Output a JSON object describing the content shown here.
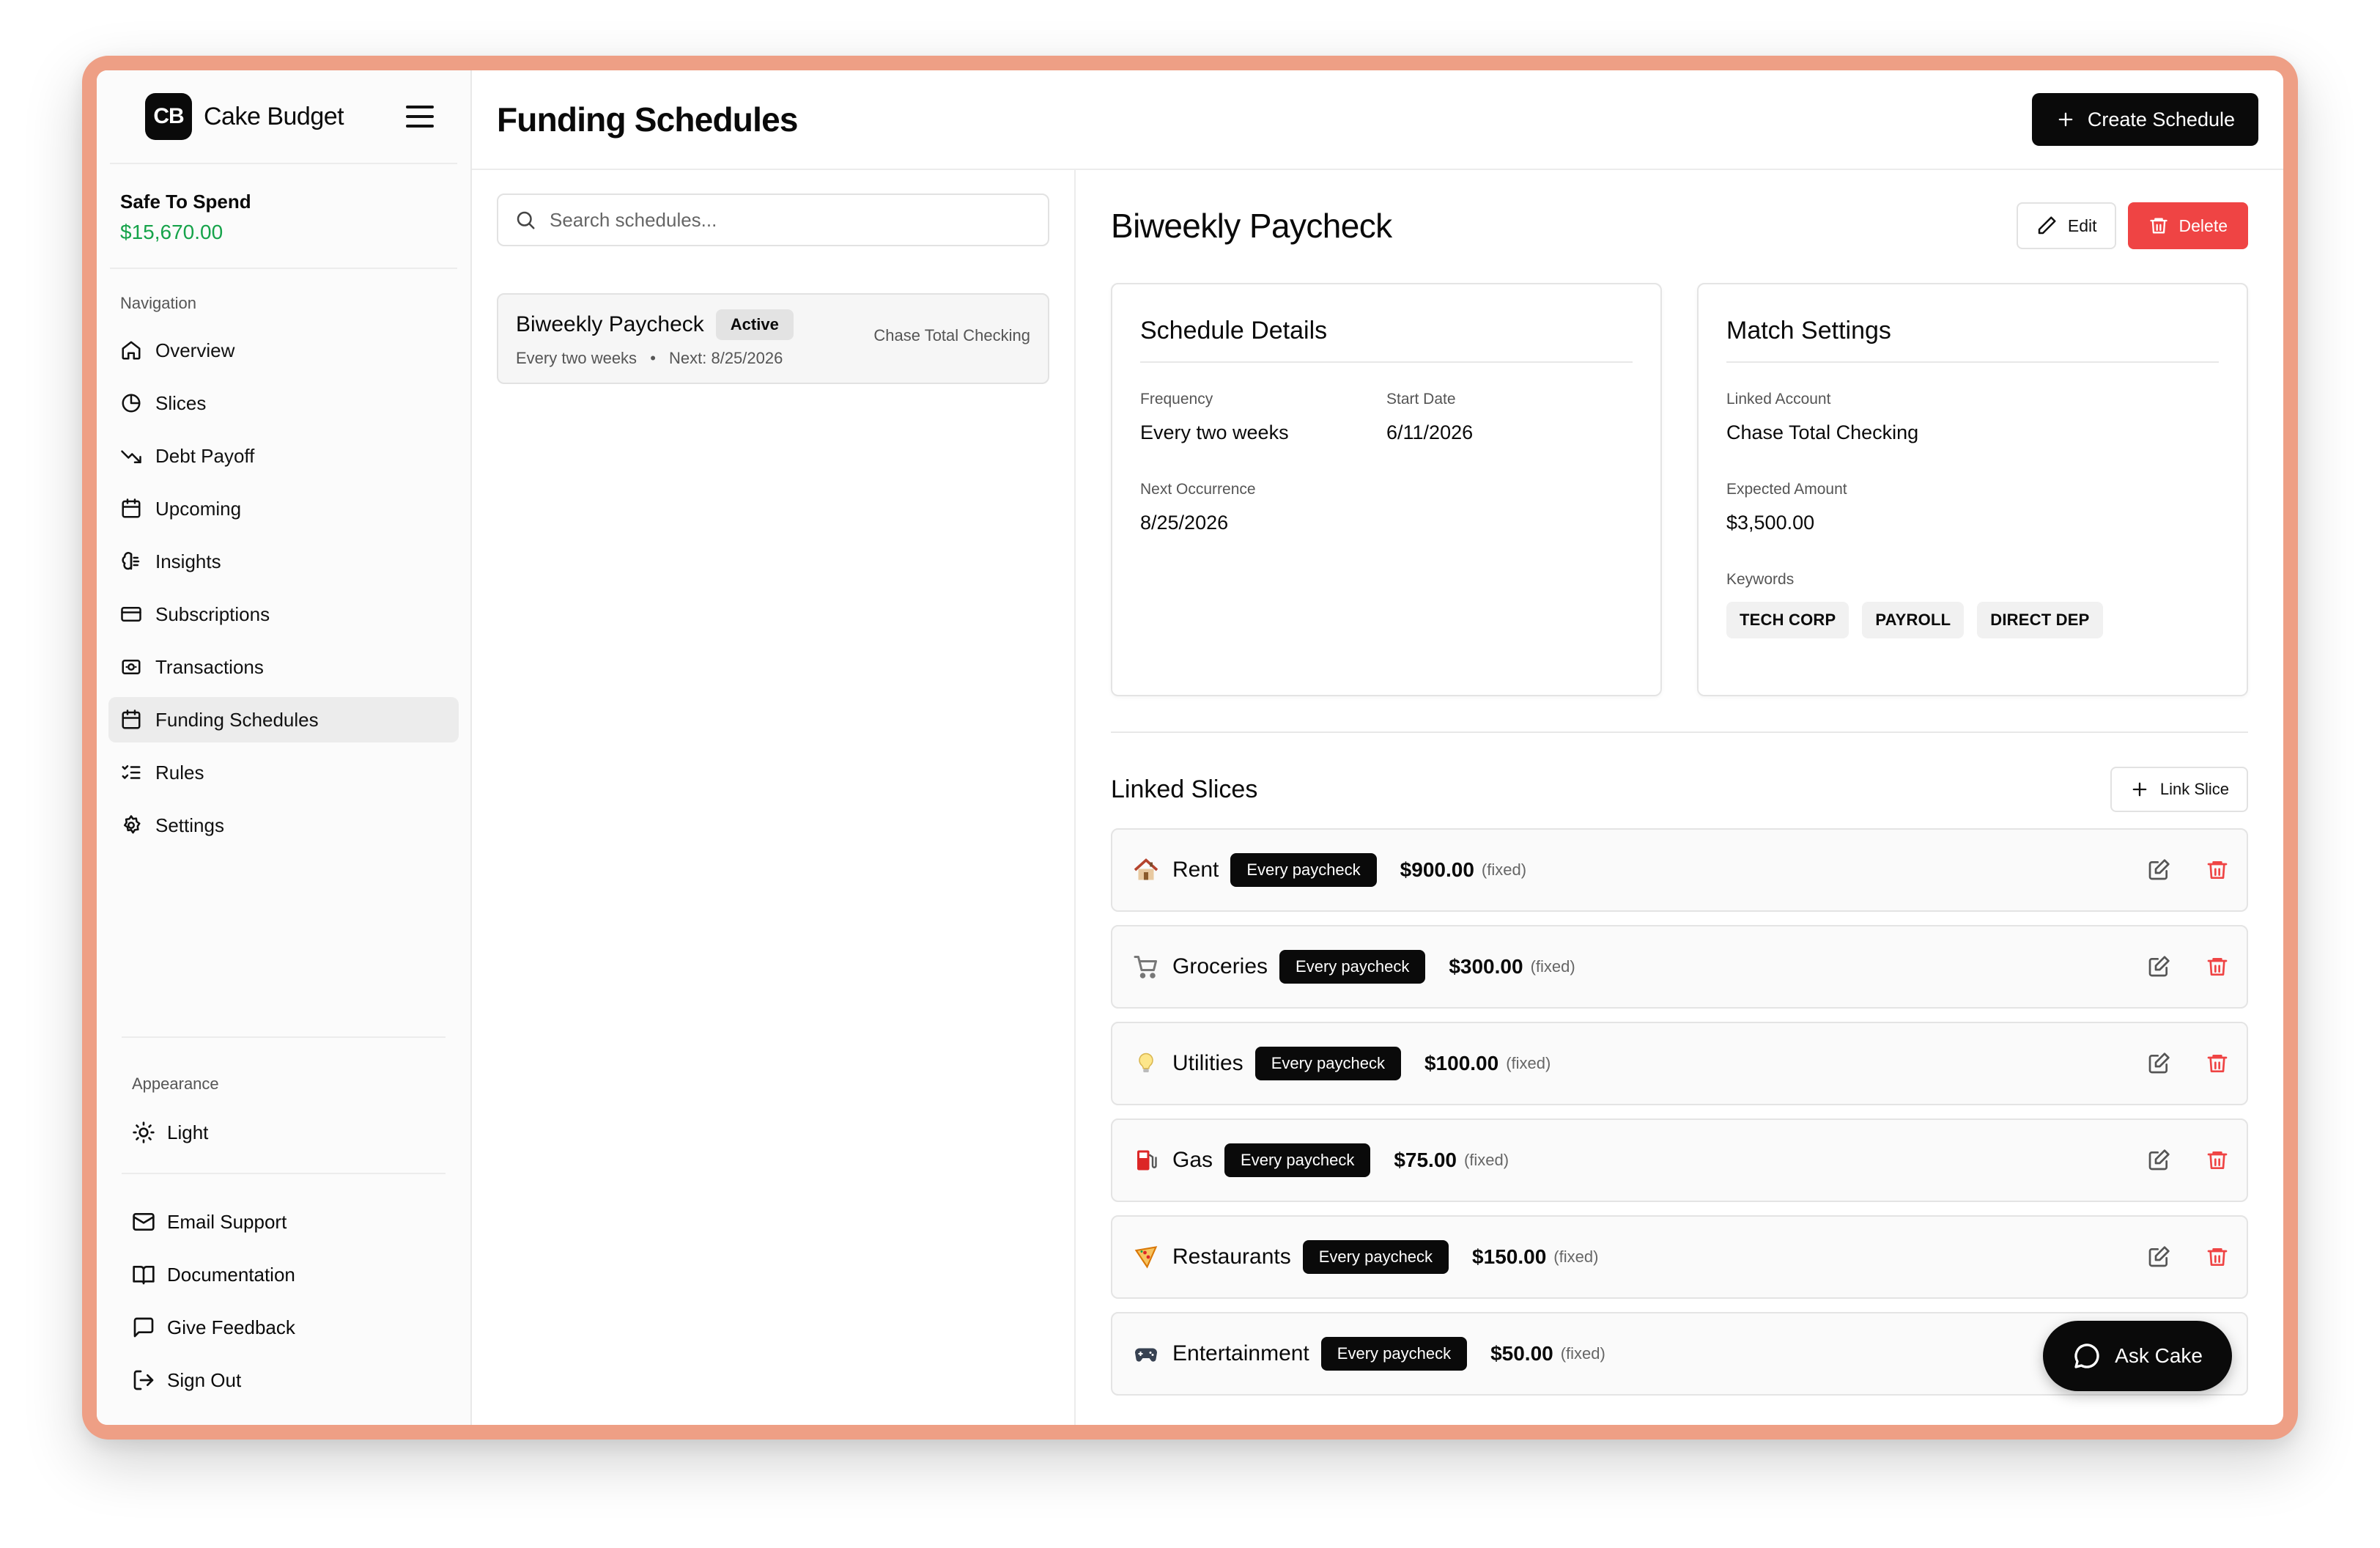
{
  "app": {
    "logo_text": "CB",
    "name": "Cake Budget"
  },
  "safe_to_spend": {
    "label": "Safe To Spend",
    "value": "$15,670.00",
    "value_color": "#16a34a"
  },
  "navigation": {
    "heading": "Navigation",
    "items": [
      {
        "label": "Overview",
        "icon": "home-icon"
      },
      {
        "label": "Slices",
        "icon": "pie-chart-icon"
      },
      {
        "label": "Debt Payoff",
        "icon": "trending-down-icon"
      },
      {
        "label": "Upcoming",
        "icon": "calendar-icon"
      },
      {
        "label": "Insights",
        "icon": "brain-icon"
      },
      {
        "label": "Subscriptions",
        "icon": "credit-card-icon"
      },
      {
        "label": "Transactions",
        "icon": "banknote-icon"
      },
      {
        "label": "Funding Schedules",
        "icon": "calendar-icon",
        "active": true
      },
      {
        "label": "Rules",
        "icon": "list-checks-icon"
      },
      {
        "label": "Settings",
        "icon": "gear-icon"
      }
    ]
  },
  "appearance": {
    "heading": "Appearance",
    "mode": "Light"
  },
  "footer_links": [
    {
      "label": "Email Support",
      "icon": "mail-icon"
    },
    {
      "label": "Documentation",
      "icon": "book-icon"
    },
    {
      "label": "Give Feedback",
      "icon": "message-square-icon"
    },
    {
      "label": "Sign Out",
      "icon": "log-out-icon"
    }
  ],
  "header": {
    "title": "Funding Schedules",
    "create_label": "Create Schedule"
  },
  "search": {
    "placeholder": "Search schedules..."
  },
  "schedule_list": [
    {
      "name": "Biweekly Paycheck",
      "status": "Active",
      "frequency": "Every two weeks",
      "next": "Next: 8/25/2026",
      "account": "Chase Total Checking"
    }
  ],
  "detail": {
    "title": "Biweekly Paycheck",
    "edit_label": "Edit",
    "delete_label": "Delete",
    "delete_color": "#ef4444",
    "schedule_details": {
      "title": "Schedule Details",
      "frequency_label": "Frequency",
      "frequency_value": "Every two weeks",
      "start_label": "Start Date",
      "start_value": "6/11/2026",
      "next_label": "Next Occurrence",
      "next_value": "8/25/2026"
    },
    "match_settings": {
      "title": "Match Settings",
      "account_label": "Linked Account",
      "account_value": "Chase Total Checking",
      "amount_label": "Expected Amount",
      "amount_value": "$3,500.00",
      "keywords_label": "Keywords",
      "keywords": [
        "TECH CORP",
        "PAYROLL",
        "DIRECT DEP"
      ]
    }
  },
  "linked_slices": {
    "title": "Linked Slices",
    "link_label": "Link Slice",
    "fixed_label": "(fixed)",
    "items": [
      {
        "emoji": "house",
        "name": "Rent",
        "frequency": "Every paycheck",
        "amount": "$900.00"
      },
      {
        "emoji": "cart",
        "name": "Groceries",
        "frequency": "Every paycheck",
        "amount": "$300.00"
      },
      {
        "emoji": "bulb",
        "name": "Utilities",
        "frequency": "Every paycheck",
        "amount": "$100.00"
      },
      {
        "emoji": "fuel",
        "name": "Gas",
        "frequency": "Every paycheck",
        "amount": "$75.00"
      },
      {
        "emoji": "pizza",
        "name": "Restaurants",
        "frequency": "Every paycheck",
        "amount": "$150.00"
      },
      {
        "emoji": "gamepad",
        "name": "Entertainment",
        "frequency": "Every paycheck",
        "amount": "$50.00"
      }
    ]
  },
  "assistant": {
    "label": "Ask Cake"
  }
}
